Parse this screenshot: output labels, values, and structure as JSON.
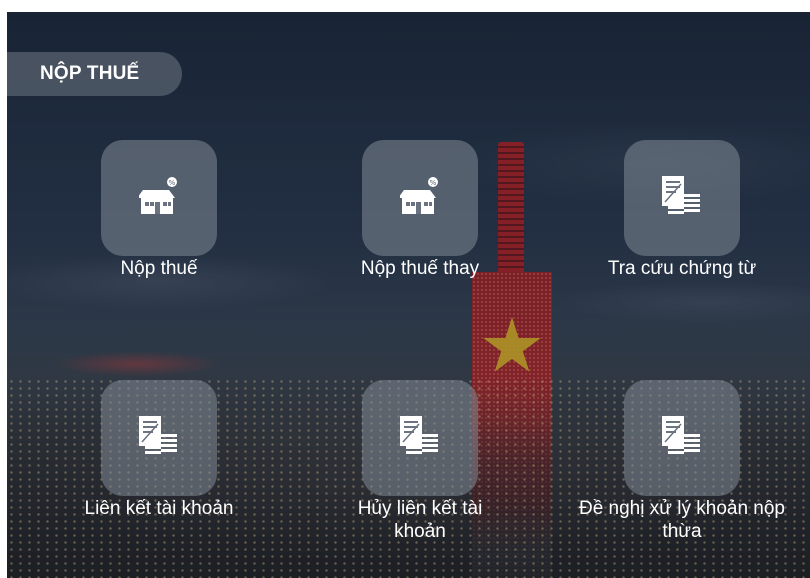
{
  "header": {
    "title": "NỘP THUẾ"
  },
  "tiles": [
    {
      "label": "Nộp thuế",
      "icon": "house-tax-icon"
    },
    {
      "label": "Nộp thuế thay",
      "icon": "house-tax-icon"
    },
    {
      "label": "Tra cứu chứng từ",
      "icon": "document-stack-icon"
    },
    {
      "label": "Liên kết tài khoản",
      "icon": "document-stack-icon"
    },
    {
      "label": "Hủy liên kết tài khoản",
      "icon": "document-stack-icon"
    },
    {
      "label": "Đề nghị xử lý khoản nộp thừa",
      "icon": "document-stack-icon"
    }
  ]
}
